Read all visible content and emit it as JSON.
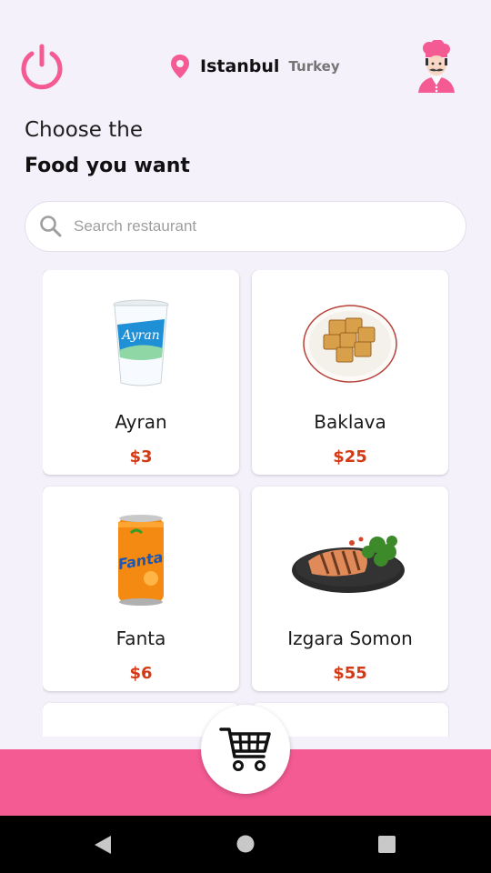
{
  "header": {
    "city": "Istanbul",
    "country": "Turkey"
  },
  "title": {
    "line1": "Choose the",
    "line2": "Food you want"
  },
  "search": {
    "placeholder": "Search restaurant",
    "value": ""
  },
  "products": [
    {
      "name": "Ayran",
      "price": "$3",
      "icon": "ayran-cup-icon"
    },
    {
      "name": "Baklava",
      "price": "$25",
      "icon": "baklava-plate-icon"
    },
    {
      "name": "Fanta",
      "price": "$6",
      "icon": "fanta-can-icon"
    },
    {
      "name": "Izgara Somon",
      "price": "$55",
      "icon": "grilled-salmon-icon"
    }
  ],
  "colors": {
    "accent": "#f45b93",
    "price": "#d33a16",
    "background": "#f4f1fb"
  }
}
